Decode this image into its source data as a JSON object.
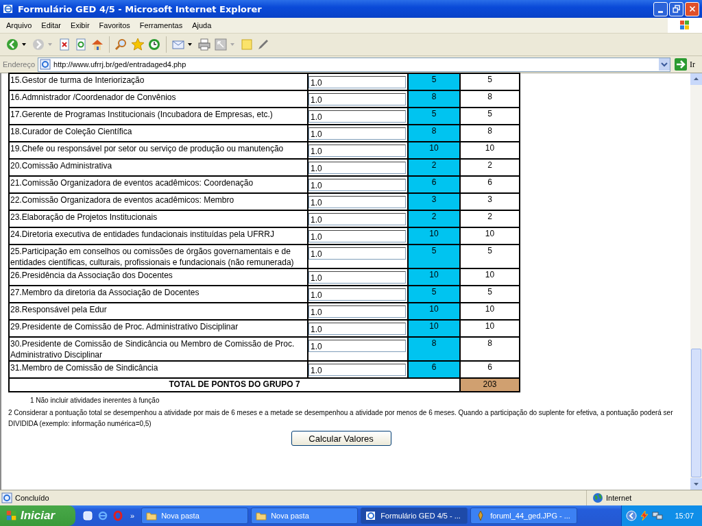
{
  "window": {
    "title": "Formulário GED 4/5 - Microsoft Internet Explorer"
  },
  "menu": [
    "Arquivo",
    "Editar",
    "Exibir",
    "Favoritos",
    "Ferramentas",
    "Ajuda"
  ],
  "address": {
    "label": "Endereço",
    "url": "http://www.ufrrj.br/ged/entradaged4.php",
    "go": "Ir"
  },
  "table": {
    "rows": [
      {
        "label": "15.Gestor de turma de Interiorização",
        "input": "1.0",
        "points": "5",
        "value": "5"
      },
      {
        "label": "16.Admnistrador /Coordenador de Convênios",
        "input": "1.0",
        "points": "8",
        "value": "8"
      },
      {
        "label": "17.Gerente de Programas Institucionais (Incubadora de Empresas, etc.)",
        "input": "1.0",
        "points": "5",
        "value": "5"
      },
      {
        "label": "18.Curador de Coleção Científica",
        "input": "1.0",
        "points": "8",
        "value": "8"
      },
      {
        "label": "19.Chefe ou responsável por setor ou serviço de produção ou manutenção",
        "input": "1.0",
        "points": "10",
        "value": "10"
      },
      {
        "label": "20.Comissão Administrativa",
        "input": "1.0",
        "points": "2",
        "value": "2"
      },
      {
        "label": "21.Comissão Organizadora de eventos acadêmicos: Coordenação",
        "input": "1.0",
        "points": "6",
        "value": "6"
      },
      {
        "label": "22.Comissão Organizadora de eventos acadêmicos: Membro",
        "input": "1.0",
        "points": "3",
        "value": "3"
      },
      {
        "label": "23.Elaboração de Projetos Institucionais",
        "input": "1.0",
        "points": "2",
        "value": "2"
      },
      {
        "label": "24.Diretoria executiva de entidades fundacionais instituídas pela UFRRJ",
        "input": "1.0",
        "points": "10",
        "value": "10"
      },
      {
        "label": "25.Participação em conselhos ou comissões de órgãos governamentais e de entidades científicas, culturais, profissionais e fundacionais (não remunerada)",
        "input": "1.0",
        "points": "5",
        "value": "5"
      },
      {
        "label": "26.Presidência da Associação dos Docentes",
        "input": "1.0",
        "points": "10",
        "value": "10"
      },
      {
        "label": "27.Membro da diretoria da Associação de Docentes",
        "input": "1.0",
        "points": "5",
        "value": "5"
      },
      {
        "label": "28.Responsável pela Edur",
        "input": "1.0",
        "points": "10",
        "value": "10"
      },
      {
        "label": "29.Presidente de Comissão de Proc. Administrativo Disciplinar",
        "input": "1.0",
        "points": "10",
        "value": "10"
      },
      {
        "label": "30.Presidente de Comissão de Sindicância ou Membro de Comissão de Proc. Administrativo Disciplinar",
        "input": "1.0",
        "points": "8",
        "value": "8"
      },
      {
        "label": "31.Membro de Comissão de Sindicância",
        "input": "1.0",
        "points": "6",
        "value": "6"
      }
    ],
    "total_label": "TOTAL DE PONTOS DO GRUPO 7",
    "total": "203"
  },
  "notes": [
    "1 Não incluir atividades inerentes à função",
    "2 Considerar a pontuação total se desempenhou a atividade por mais de 6 meses e a metade se desempenhou a atividade por menos de 6 meses. Quando a participação do suplente for efetiva, a pontuação poderá ser DIVIDIDA (exemplo: informação numérica=0,5)"
  ],
  "button": "Calcular Valores",
  "status_bar": {
    "status": "Concluído",
    "zone": "Internet"
  },
  "taskbar": {
    "start": "Iniciar",
    "tasks": [
      {
        "label": "Nova pasta",
        "selected": false,
        "kind": "folder"
      },
      {
        "label": "Nova pasta",
        "selected": false,
        "kind": "folder"
      },
      {
        "label": "Formulário GED 4/5 - ...",
        "selected": true,
        "kind": "browser"
      },
      {
        "label": "foruml_44_ged.JPG - ...",
        "selected": false,
        "kind": "image"
      }
    ],
    "chevron": "»",
    "clock": "15:07"
  }
}
